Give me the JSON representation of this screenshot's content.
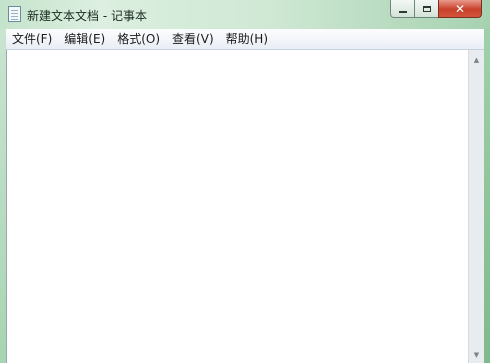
{
  "window": {
    "title": "新建文本文档 - 记事本"
  },
  "caption_buttons": {
    "close_label": "✕"
  },
  "menu": {
    "items": [
      {
        "label": "文件(F)"
      },
      {
        "label": "编辑(E)"
      },
      {
        "label": "格式(O)"
      },
      {
        "label": "查看(V)"
      },
      {
        "label": "帮助(H)"
      }
    ]
  },
  "editor": {
    "text": ""
  },
  "icons": {
    "app": "notepad-icon",
    "minimize": "minimize-icon",
    "maximize": "maximize-icon",
    "close": "close-icon",
    "scroll_up": "chevron-up-icon",
    "scroll_down": "chevron-down-icon"
  },
  "colors": {
    "frame": "#c4e3cb",
    "close_button": "#c8402a",
    "menu_bar": "#fdfdfe",
    "editor_background": "#ffffff"
  }
}
